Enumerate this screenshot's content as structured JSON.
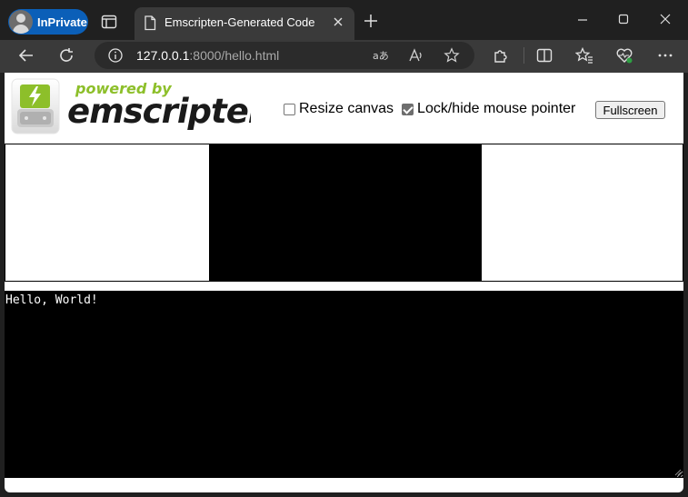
{
  "browser": {
    "inprivate_label": "InPrivate",
    "tab_title": "Emscripten-Generated Code",
    "url_host": "127.0.0.1",
    "url_rest": ":8000/hello.html"
  },
  "logo": {
    "powered_by": "powered by",
    "name": "emscripten"
  },
  "controls": {
    "resize_canvas": {
      "label": "Resize canvas",
      "checked": false
    },
    "lock_pointer": {
      "label": "Lock/hide mouse pointer",
      "checked": true
    },
    "fullscreen_label": "Fullscreen"
  },
  "output": {
    "text": "Hello, World!"
  },
  "colors": {
    "inprivate": "#0b5fb8",
    "logo_green": "#8dbf2a"
  }
}
